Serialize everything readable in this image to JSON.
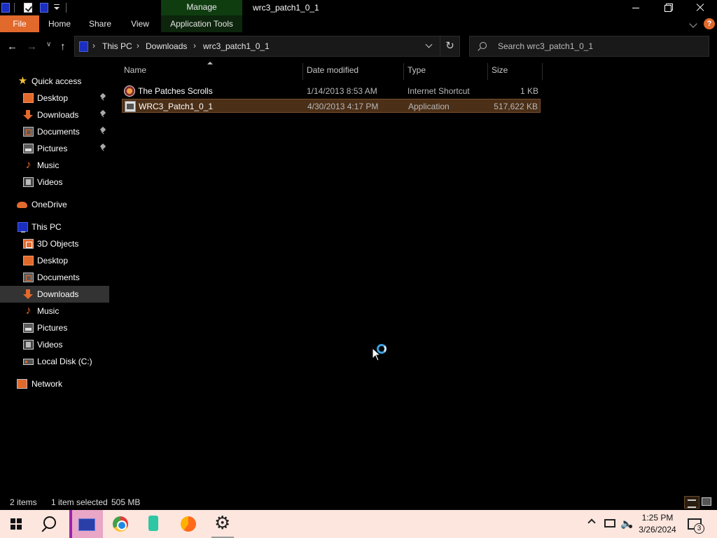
{
  "window": {
    "title": "wrc3_patch1_0_1",
    "context_tab_group": "Manage"
  },
  "ribbon": {
    "tabs": [
      "File",
      "Home",
      "Share",
      "View",
      "Application Tools"
    ],
    "help_label": "?"
  },
  "address": {
    "breadcrumbs": [
      "This PC",
      "Downloads",
      "wrc3_patch1_0_1"
    ],
    "separator": "›"
  },
  "search": {
    "placeholder": "Search wrc3_patch1_0_1"
  },
  "sidebar": {
    "items": [
      {
        "label": "Quick access",
        "icon": "star-icon",
        "pinned": false
      },
      {
        "label": "Desktop",
        "icon": "desktop-folder-icon",
        "pinned": true
      },
      {
        "label": "Downloads",
        "icon": "downloads-arrow-icon",
        "pinned": true
      },
      {
        "label": "Documents",
        "icon": "documents-icon",
        "pinned": true
      },
      {
        "label": "Pictures",
        "icon": "pictures-icon",
        "pinned": true
      },
      {
        "label": "Music",
        "icon": "music-note-icon",
        "pinned": false
      },
      {
        "label": "Videos",
        "icon": "videos-icon",
        "pinned": false
      },
      {
        "label": "OneDrive",
        "icon": "onedrive-cloud-icon",
        "pinned": false
      },
      {
        "label": "This PC",
        "icon": "this-pc-icon",
        "pinned": false
      },
      {
        "label": "3D Objects",
        "icon": "3d-objects-icon",
        "pinned": false
      },
      {
        "label": "Desktop",
        "icon": "desktop-folder-icon",
        "pinned": false
      },
      {
        "label": "Documents",
        "icon": "documents-icon",
        "pinned": false
      },
      {
        "label": "Downloads",
        "icon": "downloads-arrow-icon",
        "pinned": false,
        "selected": true
      },
      {
        "label": "Music",
        "icon": "music-note-icon",
        "pinned": false
      },
      {
        "label": "Pictures",
        "icon": "pictures-icon",
        "pinned": false
      },
      {
        "label": "Videos",
        "icon": "videos-icon",
        "pinned": false
      },
      {
        "label": "Local Disk (C:)",
        "icon": "local-disk-icon",
        "pinned": false
      },
      {
        "label": "Network",
        "icon": "network-icon",
        "pinned": false
      }
    ]
  },
  "filelist": {
    "columns": [
      "Name",
      "Date modified",
      "Type",
      "Size"
    ],
    "rows": [
      {
        "name": "The Patches Scrolls",
        "date": "1/14/2013 8:53 AM",
        "type": "Internet Shortcut",
        "size": "1 KB",
        "icon": "internet-shortcut-icon",
        "selected": false
      },
      {
        "name": "WRC3_Patch1_0_1",
        "date": "4/30/2013 4:17 PM",
        "type": "Application",
        "size": "517,622 KB",
        "icon": "application-exe-icon",
        "selected": true
      }
    ]
  },
  "status": {
    "item_count": "2 items",
    "selection": "1 item selected",
    "selection_size": "505 MB"
  },
  "taskbar": {
    "apps": [
      "start-windows-icon",
      "search-icon",
      "file-explorer-icon",
      "chrome-icon",
      "app-icon",
      "edge-icon",
      "settings-gear-icon"
    ],
    "clock_time": "1:25 PM",
    "clock_date": "3/26/2024",
    "notification_count": "3"
  },
  "colors": {
    "accent": "#e2692c",
    "selection": "#4b2f17",
    "taskbar": "#fde6de",
    "manage_tab": "#0f3d10"
  }
}
